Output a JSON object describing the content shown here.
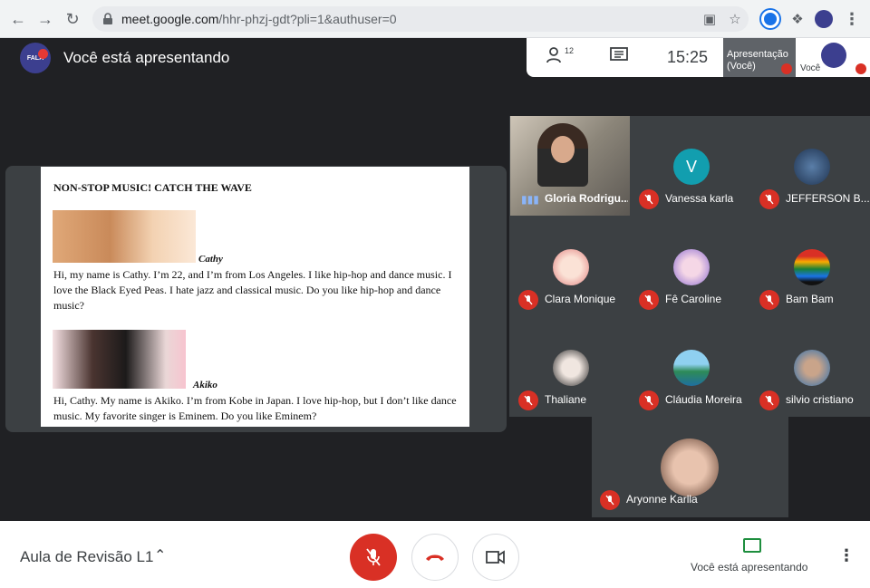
{
  "browser": {
    "url_host": "meet.google.com",
    "url_path": "/hhr-phzj-gdt?pli=1&authuser=0"
  },
  "meet": {
    "presenting_title": "Você está apresentando",
    "logo_text": "FALA",
    "participant_count": "12",
    "time": "15:25",
    "presentation_thumb_label": "Apresentação (Você)",
    "you_label": "Você"
  },
  "document": {
    "title": "NON-STOP MUSIC! CATCH THE WAVE",
    "name1": "Cathy",
    "para1": "Hi, my name is Cathy. I’m 22, and I’m from Los Angeles. I like hip-hop and dance music. I love the Black Eyed Peas. I hate jazz and classical music. Do you like hip-hop and dance music?",
    "name2": "Akiko",
    "para2": "Hi, Cathy. My name is Akiko. I’m from Kobe in Japan. I love hip-hop, but I don’t like dance music. My favorite singer is Eminem. Do you like Eminem?"
  },
  "participants": [
    {
      "name": "Gloria Rodrigu...",
      "avatar": "video",
      "color": "#7b7b7b"
    },
    {
      "name": "Vanessa karla",
      "avatar": "V",
      "color": "#129eaf"
    },
    {
      "name": "JEFFERSON B...",
      "avatar": "photo",
      "color": "#2c4b73"
    },
    {
      "name": "Clara Monique",
      "avatar": "photo",
      "color": "#e88f8f"
    },
    {
      "name": "Fê Caroline",
      "avatar": "photo",
      "color": "#9b7bd4"
    },
    {
      "name": "Bam Bam",
      "avatar": "photo",
      "color": "#1a1a1a"
    },
    {
      "name": "Thaliane",
      "avatar": "photo",
      "color": "#3a3a3a"
    },
    {
      "name": "Cláudia Moreira",
      "avatar": "photo",
      "color": "#4fa3c7"
    },
    {
      "name": "silvio cristiano",
      "avatar": "photo",
      "color": "#7a8a9a"
    },
    {
      "name": "Aryonne Karlla",
      "avatar": "photo",
      "color": "#c89b86"
    }
  ],
  "bottom": {
    "meeting_name": "Aula de Revisão L1",
    "presenting_label": "Você está apresentando"
  },
  "colors": {
    "mute_red": "#d93025",
    "meet_bg": "#202124",
    "tile_bg": "#3c4043"
  }
}
